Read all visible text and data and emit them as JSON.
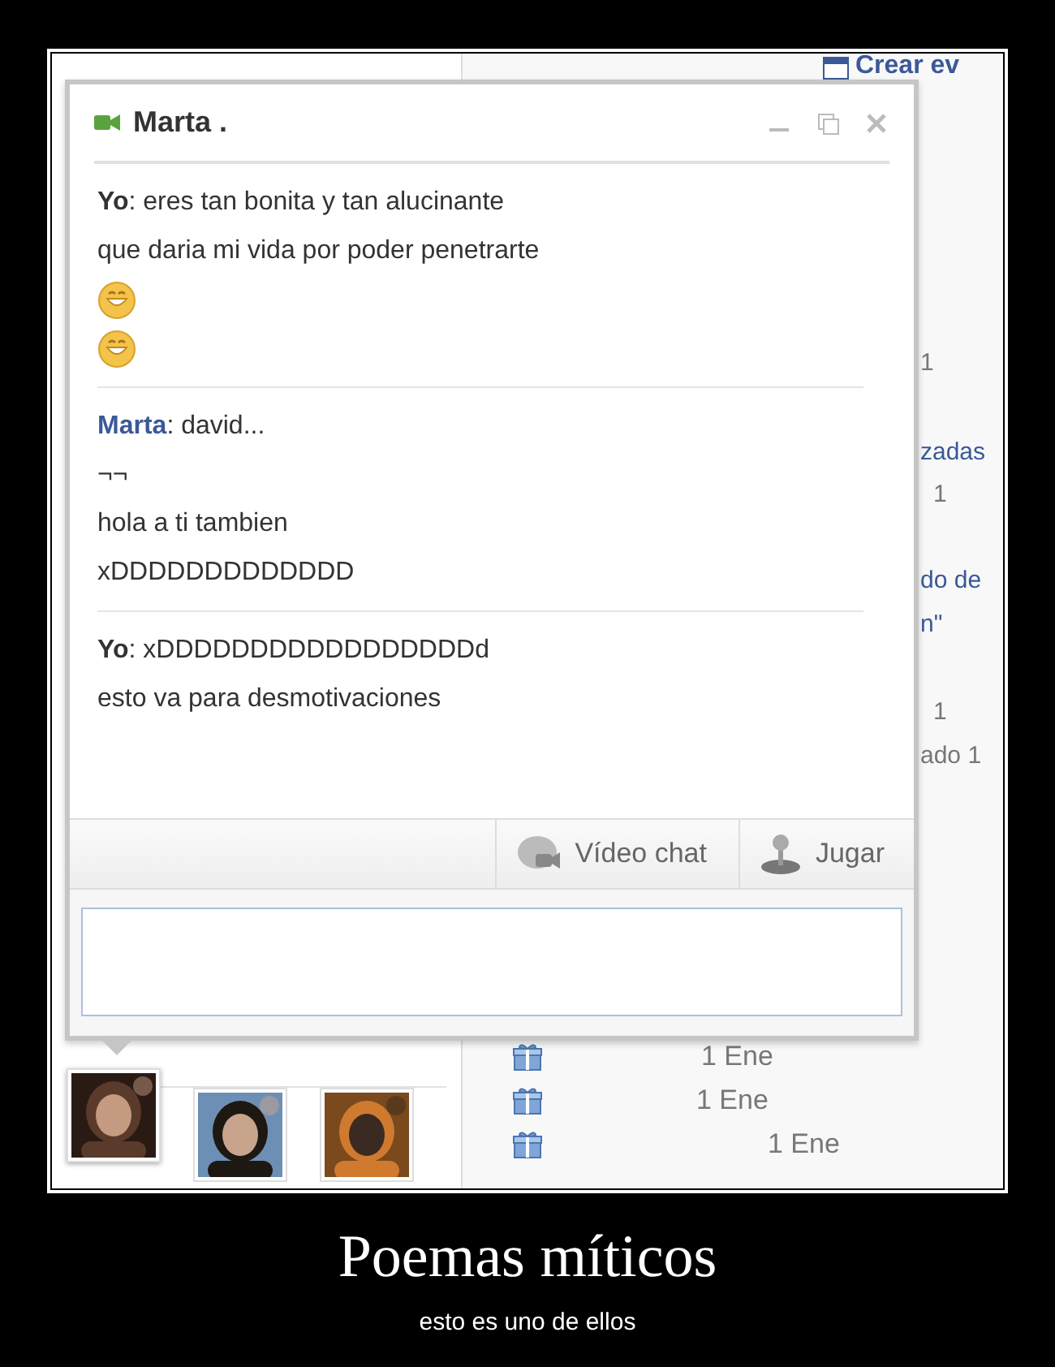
{
  "chat": {
    "title": "Marta .",
    "messages": [
      {
        "is_self": true,
        "lines": [
          {
            "kind": "text",
            "text": "**Yo**: eres tan bonita y tan alucinante"
          },
          {
            "kind": "text",
            "text": "que daria mi vida por poder penetrarte"
          },
          {
            "kind": "emoticon"
          },
          {
            "kind": "emoticon"
          }
        ]
      },
      {
        "is_self": false,
        "lines": [
          {
            "kind": "text",
            "text": "**Marta**: david..."
          },
          {
            "kind": "text",
            "text": "¬¬"
          },
          {
            "kind": "text",
            "text": "hola a ti tambien"
          },
          {
            "kind": "text",
            "text": "xDDDDDDDDDDDDD"
          }
        ]
      },
      {
        "is_self": true,
        "lines": [
          {
            "kind": "text",
            "text": "**Yo**: xDDDDDDDDDDDDDDDDDd"
          },
          {
            "kind": "text",
            "text": "esto va para desmotivaciones"
          }
        ]
      }
    ],
    "actions": [
      {
        "kind": "video",
        "label": "Vídeo chat"
      },
      {
        "kind": "game",
        "label": "Jugar"
      }
    ]
  },
  "contacts": [
    {
      "kind": "picture",
      "selected": true
    },
    {
      "kind": "picture",
      "selected": false
    },
    {
      "kind": "picture",
      "selected": false
    }
  ],
  "calendar": {
    "create_link": "Crear ev",
    "snippets": [
      "1",
      "zadas",
      "1",
      "do de",
      "n\"",
      "1",
      "ado 1"
    ],
    "birthdays": [
      "1 Ene",
      "1 Ene",
      "1 Ene"
    ]
  },
  "poster": {
    "title": "Poemas míticos",
    "caption": "esto es uno de ellos"
  }
}
